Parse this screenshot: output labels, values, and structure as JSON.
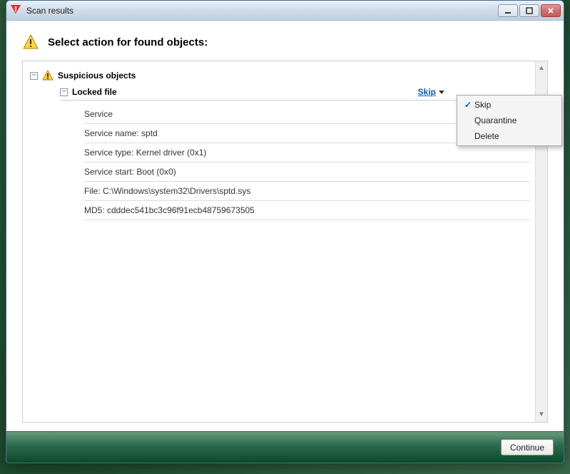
{
  "window": {
    "title": "Scan results"
  },
  "header": {
    "title": "Select action for found objects:"
  },
  "tree": {
    "category_label": "Suspicious objects",
    "subcategory_label": "Locked file",
    "action_label": "Skip",
    "details": [
      "Service",
      "Service name: sptd",
      "Service type: Kernel driver (0x1)",
      "Service start: Boot (0x0)",
      "File: C:\\Windows\\system32\\Drivers\\sptd.sys",
      "MD5: cdddec541bc3c96f91ecb48759673505"
    ]
  },
  "menu": {
    "items": [
      {
        "label": "Skip",
        "checked": true
      },
      {
        "label": "Quarantine",
        "checked": false
      },
      {
        "label": "Delete",
        "checked": false
      }
    ]
  },
  "footer": {
    "continue_label": "Continue"
  }
}
